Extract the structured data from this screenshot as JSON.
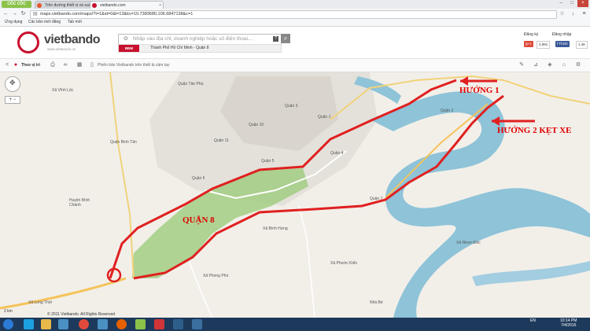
{
  "browser": {
    "brand": "CỐC CỐC",
    "tabs": [
      {
        "label": "Trên đường thiết vị và xuất...",
        "color": "#e4572e"
      },
      {
        "label": "vietbando.com",
        "color": "#c8102e"
      }
    ],
    "url": "maps.vietbando.com/maps/?t=1&st=0&l=13&kv=10.7383680,106.6847138&c=1",
    "bookmarks": [
      "Ứng dụng",
      "Các bản mới đăng",
      "Tab mới"
    ]
  },
  "site": {
    "logo": "vietbando",
    "logo_sub": "www.vietbando.vn",
    "search_placeholder": "Nhập vào địa chỉ, doanh nghiệp hoặc số điện thoại...",
    "map_button": "BĐM",
    "region": "Thành Phố Hồ Chí Minh - Quận 8",
    "login": "Đăng ký",
    "signup": "Đăng nhập",
    "gplus_count": "2,991",
    "like_label": "Thích",
    "like_count": "1.4K"
  },
  "toolbar": {
    "follow_label": "Theo vị trí",
    "mobile_text": "Phiên bản Vietbando trên thiết bị cầm tay"
  },
  "map": {
    "annotations": {
      "a1": "HƯỚNG 1",
      "a2": "HƯỚNG 2 KẸT XE",
      "a3": "QUẬN 8"
    },
    "labels": [
      "Quận Tân Phú",
      "Quận Bình Tân",
      "Quận 11",
      "Quận 10",
      "Quận 3",
      "Quận 1",
      "Quận 5",
      "Quận 6",
      "Quận 4",
      "Quận 7",
      "Quận 2",
      "Huyện Bình Chánh",
      "Nhà Bè",
      "Xã Vĩnh Lộc",
      "Xã Bình Hưng",
      "Xã Phước Kiển",
      "Xã Phong Phú",
      "Xã Nhơn Đức",
      "Xã Long Thới"
    ],
    "scale": "2 km",
    "copyright": "© 2011 Vietbando. All Rights Reserved"
  },
  "taskbar": {
    "lang": "EN",
    "time": "10:14 PM",
    "date": "7/4/2016"
  }
}
